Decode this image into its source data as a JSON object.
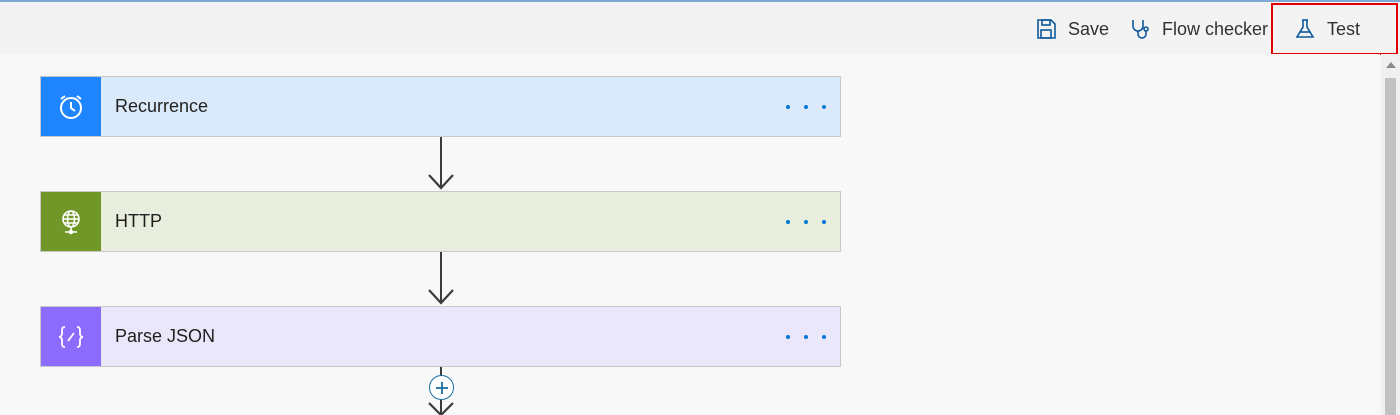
{
  "toolbar": {
    "save_label": "Save",
    "save_icon": "save-icon",
    "flow_checker_label": "Flow checker",
    "flow_checker_icon": "stethoscope-icon",
    "test_label": "Test",
    "test_icon": "flask-icon",
    "test_highlight_color": "#e00000"
  },
  "flow": {
    "steps": [
      {
        "title": "Recurrence",
        "icon": "alarm-clock-icon",
        "accent": "#1f85ff",
        "background": "#dbeafb"
      },
      {
        "title": "HTTP",
        "icon": "globe-icon",
        "accent": "#709727",
        "background": "#e8eedd"
      },
      {
        "title": "Parse JSON",
        "icon": "json-braces-icon",
        "accent": "#8c6cff",
        "background": "#ebe7fb"
      }
    ],
    "more_options_icon": "ellipsis-icon",
    "add_step_icon": "plus-icon",
    "link_color": "#0078d4"
  }
}
